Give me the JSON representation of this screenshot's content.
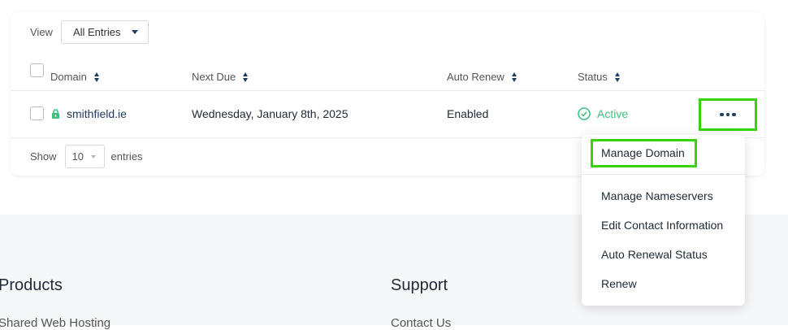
{
  "filter": {
    "label": "View",
    "selected": "All Entries"
  },
  "table": {
    "columns": [
      "Domain",
      "Next Due",
      "Auto Renew",
      "Status"
    ],
    "row": {
      "domain": "smithfield.ie",
      "next_due": "Wednesday, January 8th, 2025",
      "auto_renew": "Enabled",
      "status": "Active"
    }
  },
  "pagination": {
    "show_label": "Show",
    "page_size": "10",
    "entries_label": "entries"
  },
  "actions_menu": {
    "items": [
      "Manage Domain",
      "Manage Nameservers",
      "Edit Contact Information",
      "Auto Renewal Status",
      "Renew"
    ]
  },
  "footer": {
    "products_title": "Products",
    "products_link": "Shared Web Hosting",
    "support_title": "Support",
    "support_link": "Contact Us"
  },
  "colors": {
    "accent": "#1f3b63",
    "active": "#3dc07e",
    "highlight": "#3ad20b"
  },
  "icons": {
    "lock": "lock-icon",
    "status": "check-circle-icon",
    "more": "more-dots-icon"
  }
}
